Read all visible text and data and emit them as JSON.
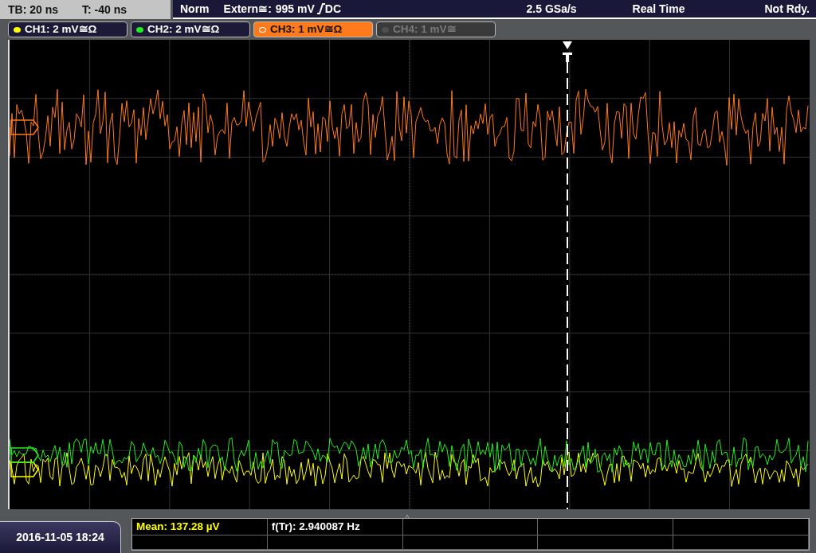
{
  "header": {
    "timebase": "TB: 20 ns",
    "trigger_time": "T: -40 ns",
    "mode": "Norm",
    "trigger_source": "Extern≅:",
    "trigger_level": "995 mV",
    "trigger_coupling": "DC",
    "sample_rate": "2.5 GSa/s",
    "acquisition": "Real Time",
    "status": "Not Rdy."
  },
  "channels": [
    {
      "label": "CH1: 2 mV≅Ω",
      "color": "#ffff00",
      "selected": false,
      "enabled": true
    },
    {
      "label": "CH2: 2 mV≅Ω",
      "color": "#22ee22",
      "selected": false,
      "enabled": true
    },
    {
      "label": "CH3: 1 mV≅Ω",
      "color": "#ff7a1a",
      "selected": true,
      "enabled": true
    },
    {
      "label": "CH4: 1 mV≅",
      "color": "#505050",
      "selected": false,
      "enabled": false
    }
  ],
  "measurements": [
    {
      "text": "Mean: 137.28 µV",
      "color": "#ffff00"
    },
    {
      "text": "f(Tr): 2.940087 Hz",
      "color": "#ffffff"
    }
  ],
  "datetime": "2016-11-05 18:24"
}
